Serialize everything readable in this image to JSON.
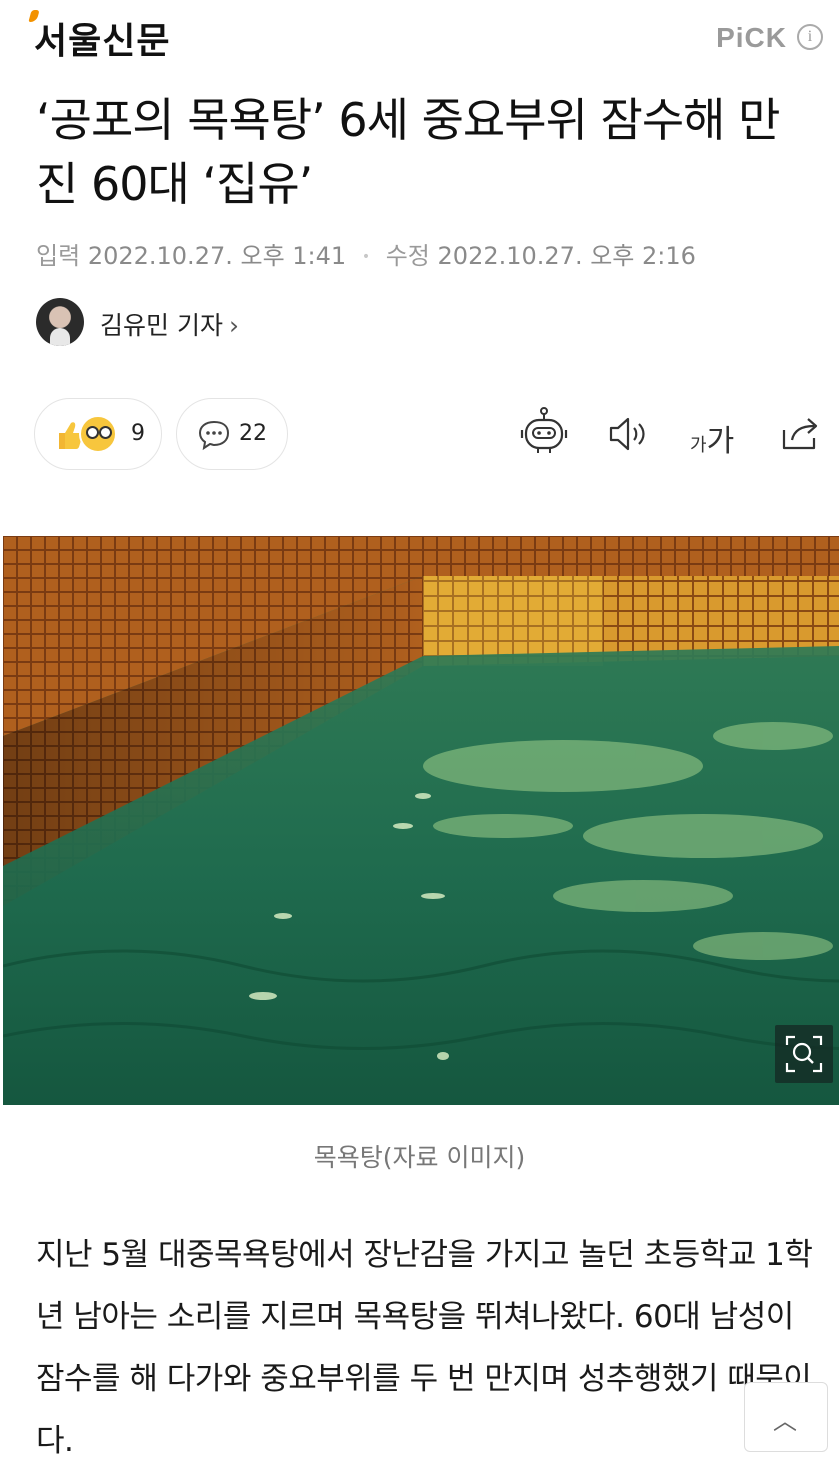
{
  "header": {
    "logo": "서울신문",
    "pick_label": "PiCK",
    "info_glyph": "i"
  },
  "article": {
    "title": "‘공포의 목욕탕’ 6세 중요부위 잠수해 만진 60대 ‘집유’",
    "input_label": "입력",
    "input_date": "2022.10.27. 오후 1:41",
    "edit_label": "수정",
    "edit_date": "2022.10.27. 오후 2:16",
    "author": "김유민 기자",
    "author_chevron": "›"
  },
  "toolbar": {
    "reaction_count": "9",
    "comment_count": "22",
    "font_small": "가",
    "font_large": "가",
    "icons": [
      "summary-bot-icon",
      "speaker-icon",
      "font-size-icon",
      "share-icon"
    ]
  },
  "photo": {
    "caption": "목욕탕(자료 이미지)",
    "zoom_icon": "zoom-search-icon"
  },
  "body": {
    "paragraph": "지난 5월 대중목욕탕에서 장난감을 가지고 놀던 초등학교 1학년 남아는 소리를 지르며 목욕탕을 뛰쳐나왔다. 60대 남성이 잠수를 해 다가와 중요부위를 두 번 만지며 성추행했기 때문이다."
  },
  "colors": {
    "logo_accent": "#f39200",
    "pool_water": "#1f6b4e",
    "tile": "#b5651d"
  }
}
